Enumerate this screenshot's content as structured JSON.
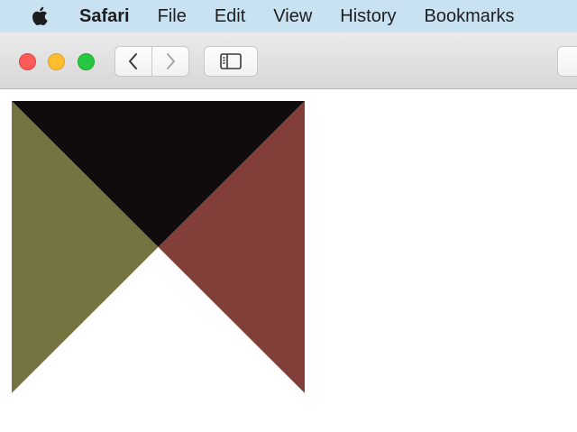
{
  "menubar": {
    "apple_icon": "apple-logo-icon",
    "items": [
      "Safari",
      "File",
      "Edit",
      "View",
      "History",
      "Bookmarks"
    ]
  },
  "toolbar": {
    "traffic_lights": [
      "close",
      "minimize",
      "zoom"
    ],
    "buttons": [
      "chevron-left-icon",
      "chevron-right-icon",
      "sidebar-icon"
    ]
  },
  "colors": {
    "menubar_bg": "#c9e2f2",
    "top_triangle": "#100c0e",
    "left_triangle": "#757340",
    "right_triangle": "#823e38",
    "bottom_triangle": "#ffffff"
  }
}
